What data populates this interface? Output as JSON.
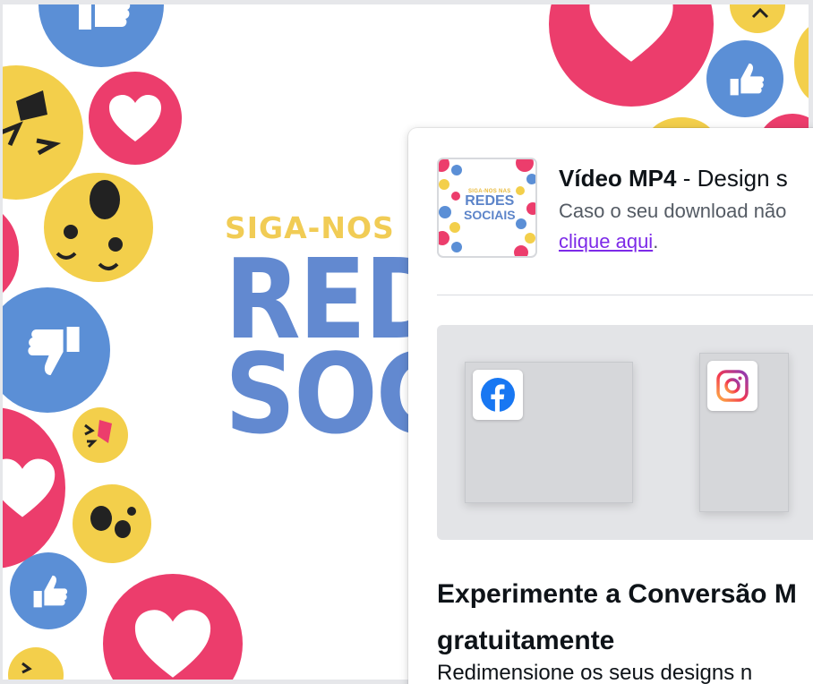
{
  "design": {
    "tagline": "SIGA-NOS NAS",
    "line1": "REDES",
    "line2": "SOCIAIS"
  },
  "thumbnail": {
    "tagline": "SIGA-NOS NAS",
    "line1": "REDES",
    "line2": "SOCIAIS"
  },
  "download": {
    "file_type": "Vídeo MP4",
    "file_suffix": " - Design s",
    "note": "Caso o seu download não",
    "link": "clique aqui",
    "link_suffix": "."
  },
  "promo": {
    "title": "Experimente a Conversão M gratuitamente",
    "description": "Redimensione os seus designs n",
    "platforms": [
      "facebook-icon",
      "instagram-icon"
    ]
  },
  "colors": {
    "heart_red": "#ec3d6c",
    "like_blue": "#5b8fd6",
    "face_yellow": "#f3cf4b",
    "title_blue": "#6289d0",
    "tagline_yellow": "#f1cc55",
    "link_purple": "#7d2ae8",
    "facebook_blue": "#1877f2"
  }
}
